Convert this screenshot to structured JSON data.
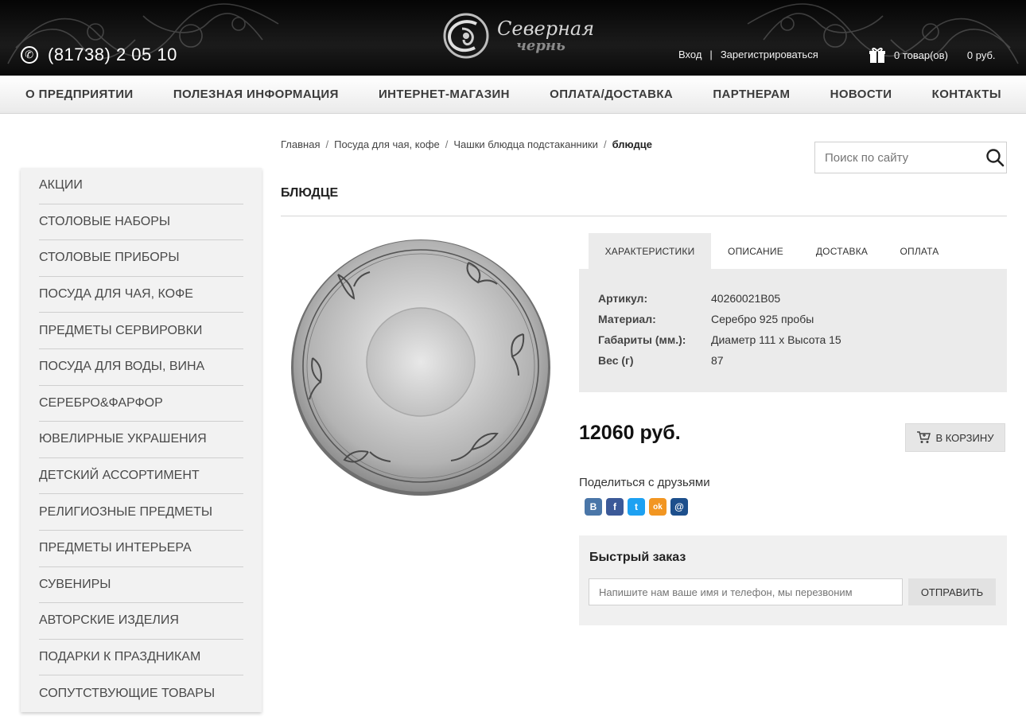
{
  "header": {
    "phone": "(81738) 2 05 10",
    "logo_line1": "Северная",
    "logo_line2": "чернь",
    "login": "Вход",
    "auth_sep": "|",
    "register": "Зарегистрироваться",
    "cart_count": "0 товар(ов)",
    "cart_total": "0 руб.",
    "icons": {
      "phone": "phone-icon",
      "cart": "gift-icon"
    }
  },
  "nav": {
    "items": [
      "О ПРЕДПРИЯТИИ",
      "ПОЛЕЗНАЯ ИНФОРМАЦИЯ",
      "ИНТЕРНЕТ-МАГАЗИН",
      "ОПЛАТА/ДОСТАВКА",
      "ПАРТНЕРАМ",
      "НОВОСТИ",
      "КОНТАКТЫ"
    ]
  },
  "sidebar": {
    "items": [
      "АКЦИИ",
      "СТОЛОВЫЕ НАБОРЫ",
      "СТОЛОВЫЕ ПРИБОРЫ",
      "ПОСУДА ДЛЯ ЧАЯ, КОФЕ",
      "ПРЕДМЕТЫ СЕРВИРОВКИ",
      "ПОСУДА ДЛЯ ВОДЫ, ВИНА",
      "СЕРЕБРО&ФАРФОР",
      "ЮВЕЛИРНЫЕ УКРАШЕНИЯ",
      "ДЕТСКИЙ АССОРТИМЕНТ",
      "РЕЛИГИОЗНЫЕ ПРЕДМЕТЫ",
      "ПРЕДМЕТЫ ИНТЕРЬЕРА",
      "СУВЕНИРЫ",
      "АВТОРСКИЕ ИЗДЕЛИЯ",
      "ПОДАРКИ К ПРАЗДНИКАМ",
      "СОПУТСТВУЮЩИЕ ТОВАРЫ"
    ]
  },
  "breadcrumb": {
    "items": [
      "Главная",
      "Посуда для чая, кофе",
      "Чашки блюдца подстаканники"
    ],
    "separator": "/",
    "current": "блюдце"
  },
  "search": {
    "placeholder": "Поиск по сайту"
  },
  "product": {
    "title": "БЛЮДЦЕ",
    "tabs": [
      "ХАРАКТЕРИСТИКИ",
      "ОПИСАНИЕ",
      "ДОСТАВКА",
      "ОПЛАТА"
    ],
    "specs": [
      {
        "key": "Артикул:",
        "value": "40260021B05"
      },
      {
        "key": "Материал:",
        "value": "Серебро 925 пробы"
      },
      {
        "key": "Габариты (мм.):",
        "value": "Диаметр 111 х Высота 15"
      },
      {
        "key": "Вес (г)",
        "value": "87"
      }
    ],
    "price": "12060 руб.",
    "add_to_cart": "В КОРЗИНУ"
  },
  "share": {
    "label": "Поделиться с друзьями",
    "networks": [
      {
        "glyph": "B",
        "color": "#4a76a8"
      },
      {
        "glyph": "f",
        "color": "#3b5998"
      },
      {
        "glyph": "t",
        "color": "#1da1f2"
      },
      {
        "glyph": "ok",
        "color": "#f29622"
      },
      {
        "glyph": "@",
        "color": "#1d4f8c"
      }
    ]
  },
  "quick_order": {
    "title": "Быстрый заказ",
    "placeholder": "Напишите нам ваше имя и телефон, мы перезвоним",
    "submit": "ОТПРАВИТЬ"
  }
}
